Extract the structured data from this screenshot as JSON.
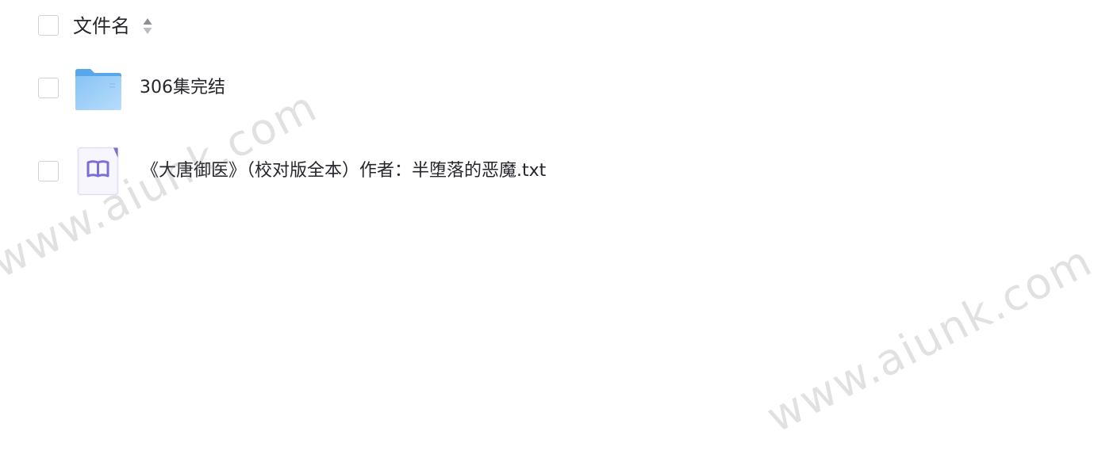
{
  "header": {
    "column_label": "文件名",
    "sort_icon": "sort-up-down-icon"
  },
  "files": [
    {
      "name": "306集完结",
      "type": "folder",
      "icon": "folder-icon"
    },
    {
      "name": "《大唐御医》（校对版全本）作者：半堕落的恶魔.txt",
      "type": "txt",
      "icon": "book-document-icon"
    }
  ],
  "watermark": {
    "text": "www.aiunk.com"
  },
  "colors": {
    "text": "#25262b",
    "checkbox_border": "#cfd2d8",
    "folder": "#6fb6f2",
    "doc_accent": "#7b6fd6"
  }
}
